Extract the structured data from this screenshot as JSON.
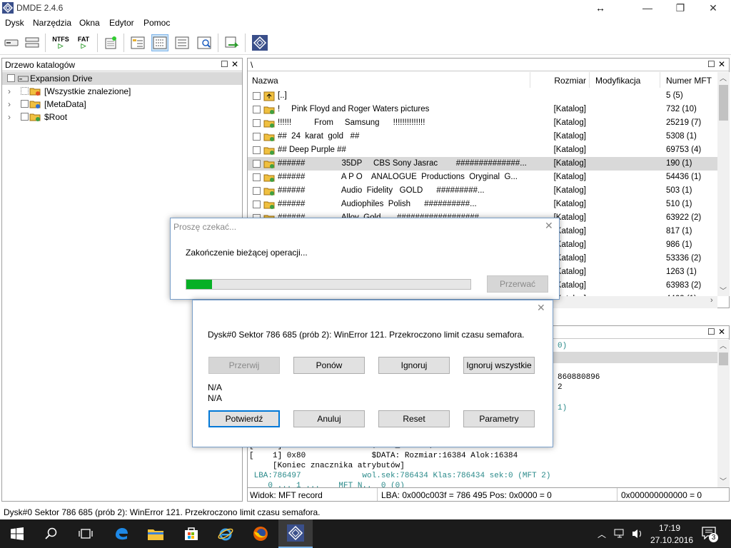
{
  "window": {
    "title": "DMDE 2.4.6"
  },
  "menu": [
    "Dysk",
    "Narzędzia",
    "Okna",
    "Edytor",
    "Pomoc"
  ],
  "toolbar": {
    "ntfs_label": "NTFS",
    "fat_label": "FAT"
  },
  "left_pane": {
    "title": "Drzewo katalogów",
    "root": "Expansion Drive",
    "items": [
      "[Wszystkie znalezione]",
      "[MetaData]",
      "$Root"
    ]
  },
  "path_bar": "\\",
  "file_list": {
    "columns": [
      "Nazwa",
      "Rozmiar",
      "Modyfikacja",
      "Numer MFT"
    ],
    "rows": [
      {
        "name": "[..]",
        "size": "",
        "mod": "",
        "mft": "5 (5)"
      },
      {
        "name": "!     Pink Floyd and Roger Waters pictures",
        "size": "[Katalog]",
        "mod": "",
        "mft": "732 (10)"
      },
      {
        "name": "!!!!!!          From     Samsung      !!!!!!!!!!!!!!",
        "size": "[Katalog]",
        "mod": "",
        "mft": "25219 (7)"
      },
      {
        "name": "##  24  karat  gold   ##",
        "size": "[Katalog]",
        "mod": "",
        "mft": "5308 (1)"
      },
      {
        "name": "## Deep Purple ##",
        "size": "[Katalog]",
        "mod": "",
        "mft": "69753 (4)"
      },
      {
        "name": "######                35DP     CBS Sony Jasrac        ##############...",
        "size": "[Katalog]",
        "mod": "",
        "mft": "190 (1)"
      },
      {
        "name": "######                A P O    ANALOGUE  Productions  Oryginal  G...",
        "size": "[Katalog]",
        "mod": "",
        "mft": "54436 (1)"
      },
      {
        "name": "######                Audio  Fidelity   GOLD      #########...",
        "size": "[Katalog]",
        "mod": "",
        "mft": "503 (1)"
      },
      {
        "name": "######                Audiophiles  Polish      ##########...",
        "size": "[Katalog]",
        "mod": "",
        "mft": "510 (1)"
      },
      {
        "name": "######                Alloy  Gold       ##################...",
        "size": "[Katalog]",
        "mod": "",
        "mft": "63922 (2)"
      },
      {
        "name": "",
        "size": "[Katalog]",
        "mod": "",
        "mft": "817 (1)"
      },
      {
        "name": "",
        "size": "[Katalog]",
        "mod": "",
        "mft": "986 (1)"
      },
      {
        "name": "",
        "size": "[Katalog]",
        "mod": "",
        "mft": "53336 (2)"
      },
      {
        "name": "",
        "size": "[Katalog]",
        "mod": "",
        "mft": "1263 (1)"
      },
      {
        "name": "",
        "size": "[Katalog]",
        "mod": "",
        "mft": "63983 (2)"
      },
      {
        "name": "",
        "size": "[Katalog]",
        "mod": "",
        "mft": "4462 (1)"
      }
    ]
  },
  "hex_pane": {
    "lines": [
      {
        "text": "0)",
        "color": "#2a8a8a"
      },
      {
        "text": "",
        "color": "#000"
      },
      {
        "text": "",
        "color": "#000"
      },
      {
        "text": "860880896",
        "color": "#000"
      },
      {
        "text": "2",
        "color": "#000"
      },
      {
        "text": "",
        "color": "#000"
      },
      {
        "text": "1)",
        "color": "#2a8a8a"
      }
    ],
    "bottom_lines": [
      {
        "text": "[    2] 0x30              $FILE_NAME: $MFTMirr",
        "color": "#000"
      },
      {
        "text": "[    1] 0x80              $DATA: Rozmiar:16384 Alok:16384",
        "color": "#000"
      },
      {
        "text": "     [Koniec znacznika atrybutów]",
        "color": "#000"
      },
      {
        "text": " LBA:786497             wol.sek:786434 Klas:786434 sek:0 (MFT 2)",
        "color": "#2a8a8a"
      },
      {
        "text": "    0 ... 1 ...    MFT N..  0 (0)",
        "color": "#2a8a8a"
      }
    ]
  },
  "status2": {
    "view": "Widok: MFT record",
    "lba": "LBA: 0x000c003f = 786 495  Pos: 0x0000 = 0",
    "hex": "0x000000000000 = 0"
  },
  "status_line": "Dysk#0 Sektor 786 685 (prób 2): WinError 121. Przekroczono limit czasu semafora.",
  "wait_dialog": {
    "title": "Proszę czekać...",
    "message": "Zakończenie bieżącej operacji...",
    "progress": 0.09,
    "abort_label": "Przerwać"
  },
  "error_dialog": {
    "message": "Dysk#0 Sektor 786 685 (prób 2): WinError 121. Przekroczono limit czasu semafora.",
    "buttons_row1": [
      "Przerwij",
      "Ponów",
      "Ignoruj",
      "Ignoruj wszystkie"
    ],
    "na1": "N/A",
    "na2": "N/A",
    "buttons_row2": [
      "Potwierdź",
      "Anuluj",
      "Reset",
      "Parametry"
    ]
  },
  "taskbar": {
    "time": "17:19",
    "date": "27.10.2016",
    "notifications": "3"
  },
  "colors": {
    "accent": "#0078d7",
    "progress": "#06b025",
    "taskbar": "#1b1b1b",
    "folder": "#f0c040"
  }
}
